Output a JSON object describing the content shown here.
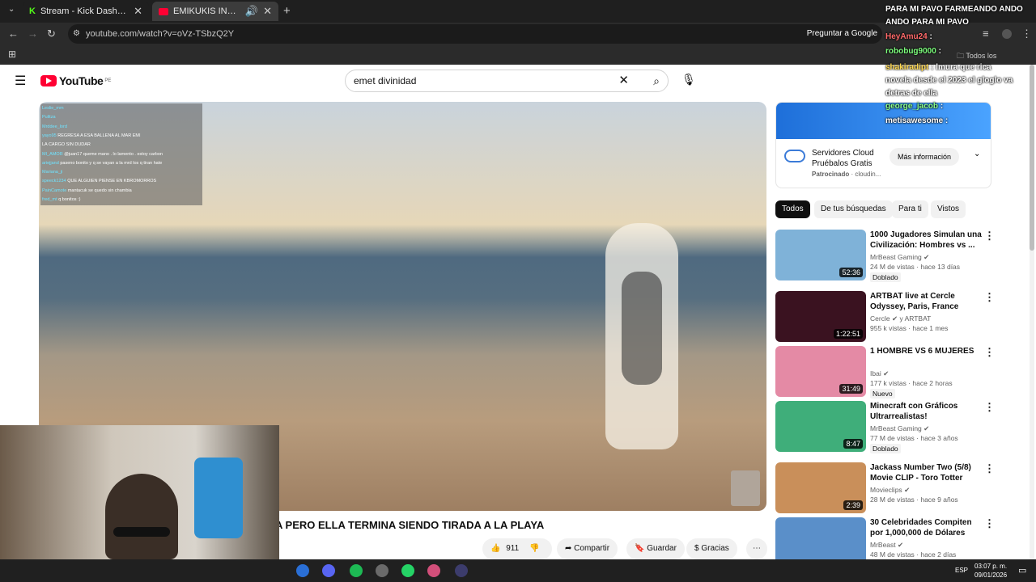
{
  "browser": {
    "tabs": [
      {
        "title": "Stream - Kick Dashboard",
        "active": false
      },
      {
        "title": "EMIKUKIS INTENTA TIRAR A",
        "active": true
      }
    ],
    "url": "youtube.com/watch?v=oVz-TSbzQ2Y",
    "ask_google_label": "Preguntar a Google",
    "bookmarks_label": "Todos los marcadores"
  },
  "youtube": {
    "logo_text": "YouTube",
    "region": "PE",
    "search_value": "emet divinidad",
    "video_title": "A PERO ELLA TERMINA SIENDO TIRADA A LA PLAYA",
    "likes": "911",
    "share_label": "Compartir",
    "save_label": "Guardar",
    "thanks_label": "Gracias",
    "ad": {
      "title_line1": "Servidores Cloud",
      "title_line2": "Pruébalos Gratis",
      "sponsored": "Patrocinado",
      "sponsor_domain": "cloudin...",
      "cta": "Más información"
    },
    "chips": [
      "Todos",
      "De tus búsquedas",
      "Para ti",
      "Vistos"
    ],
    "recommendations": [
      {
        "title": "1000 Jugadores Simulan una Civilización: Hombres vs ...",
        "channel": "MrBeast Gaming",
        "meta": "24 M de vistas · hace 13 días",
        "badge": "Doblado",
        "duration": "52:36",
        "thumb_color": "#7fb2d8"
      },
      {
        "title": "ARTBAT live at Cercle Odyssey, Paris, France",
        "channel": "Cercle",
        "channel2": "y ARTBAT",
        "meta": "955 k vistas · hace 1 mes",
        "badge": "",
        "duration": "1:22:51",
        "thumb_color": "#3a1220"
      },
      {
        "title": "1 HOMBRE VS 6 MUJERES",
        "channel": "Ibai",
        "meta": "177 k vistas · hace 2 horas",
        "badge": "Nuevo",
        "duration": "31:49",
        "thumb_color": "#e48aa5"
      },
      {
        "title": "Minecraft con Gráficos Ultrarrealistas!",
        "channel": "MrBeast Gaming",
        "meta": "77 M de vistas · hace 3 años",
        "badge": "Doblado",
        "duration": "8:47",
        "thumb_color": "#3fae7a"
      },
      {
        "title": "Jackass Number Two (5/8) Movie CLIP - Toro Totter (2006...",
        "channel": "Movieclips",
        "meta": "28 M de vistas · hace 9 años",
        "badge": "",
        "duration": "2:39",
        "thumb_color": "#c98f5a"
      },
      {
        "title": "30 Celebridades Compiten por 1,000,000 de Dólares",
        "channel": "MrBeast",
        "meta": "48 M de vistas · hace 2 días",
        "badge": "",
        "duration": "",
        "thumb_color": "#5a8fc9"
      }
    ]
  },
  "stream_chat": {
    "lines": [
      {
        "user": "",
        "text": "PARA MI PAVO FARMEANDO ANDO",
        "color": "#ffffff"
      },
      {
        "user": "",
        "text": "ANDO PARA MI PAVO",
        "color": "#ffffff"
      },
      {
        "user": "HeyAmu24",
        "text": ":",
        "color": "#ff6a6a"
      },
      {
        "user": "robobug9000",
        "text": ":",
        "color": "#7dff7d"
      },
      {
        "user": "shakiradipt",
        "text": ": lmura que rica novela desde el 2023 el gloglo va detras de ella",
        "color": "#ffd84d"
      },
      {
        "user": "george_jacob",
        "text": ":",
        "color": "#8cff8c"
      },
      {
        "user": "",
        "text": "metisawesome :",
        "color": "#ffffff"
      }
    ],
    "inplayer": [
      {
        "user": "Leslie_mm",
        "text": ""
      },
      {
        "user": "Pulitza",
        "text": ""
      },
      {
        "user": "Mrddee_lord",
        "text": ""
      },
      {
        "user": "yayo95",
        "text": "REGRESA A ESA BALLENA AL MAR EMI"
      },
      {
        "user": "",
        "text": "LA CARGO SIN DUDAR"
      },
      {
        "user": "MI_AMOR",
        "text": "@juan17 queme mano . lo lamento . estoy carbon"
      },
      {
        "user": "ariejjand",
        "text": "paseno bonito y q se vayan a la mrd los q tiran hate"
      },
      {
        "user": "Mariana_ji",
        "text": ""
      },
      {
        "user": "speeck1234",
        "text": "QUE ALGUIEN PIENSE EN KBROMORROS"
      },
      {
        "user": "PainCamote",
        "text": "mantacuk se quedo sin chambia"
      },
      {
        "user": "fred_mt",
        "text": "q bonitos :)"
      }
    ]
  },
  "taskbar": {
    "lang": "ESP",
    "time": "03:07 p. m.",
    "date": "09/01/2026"
  }
}
